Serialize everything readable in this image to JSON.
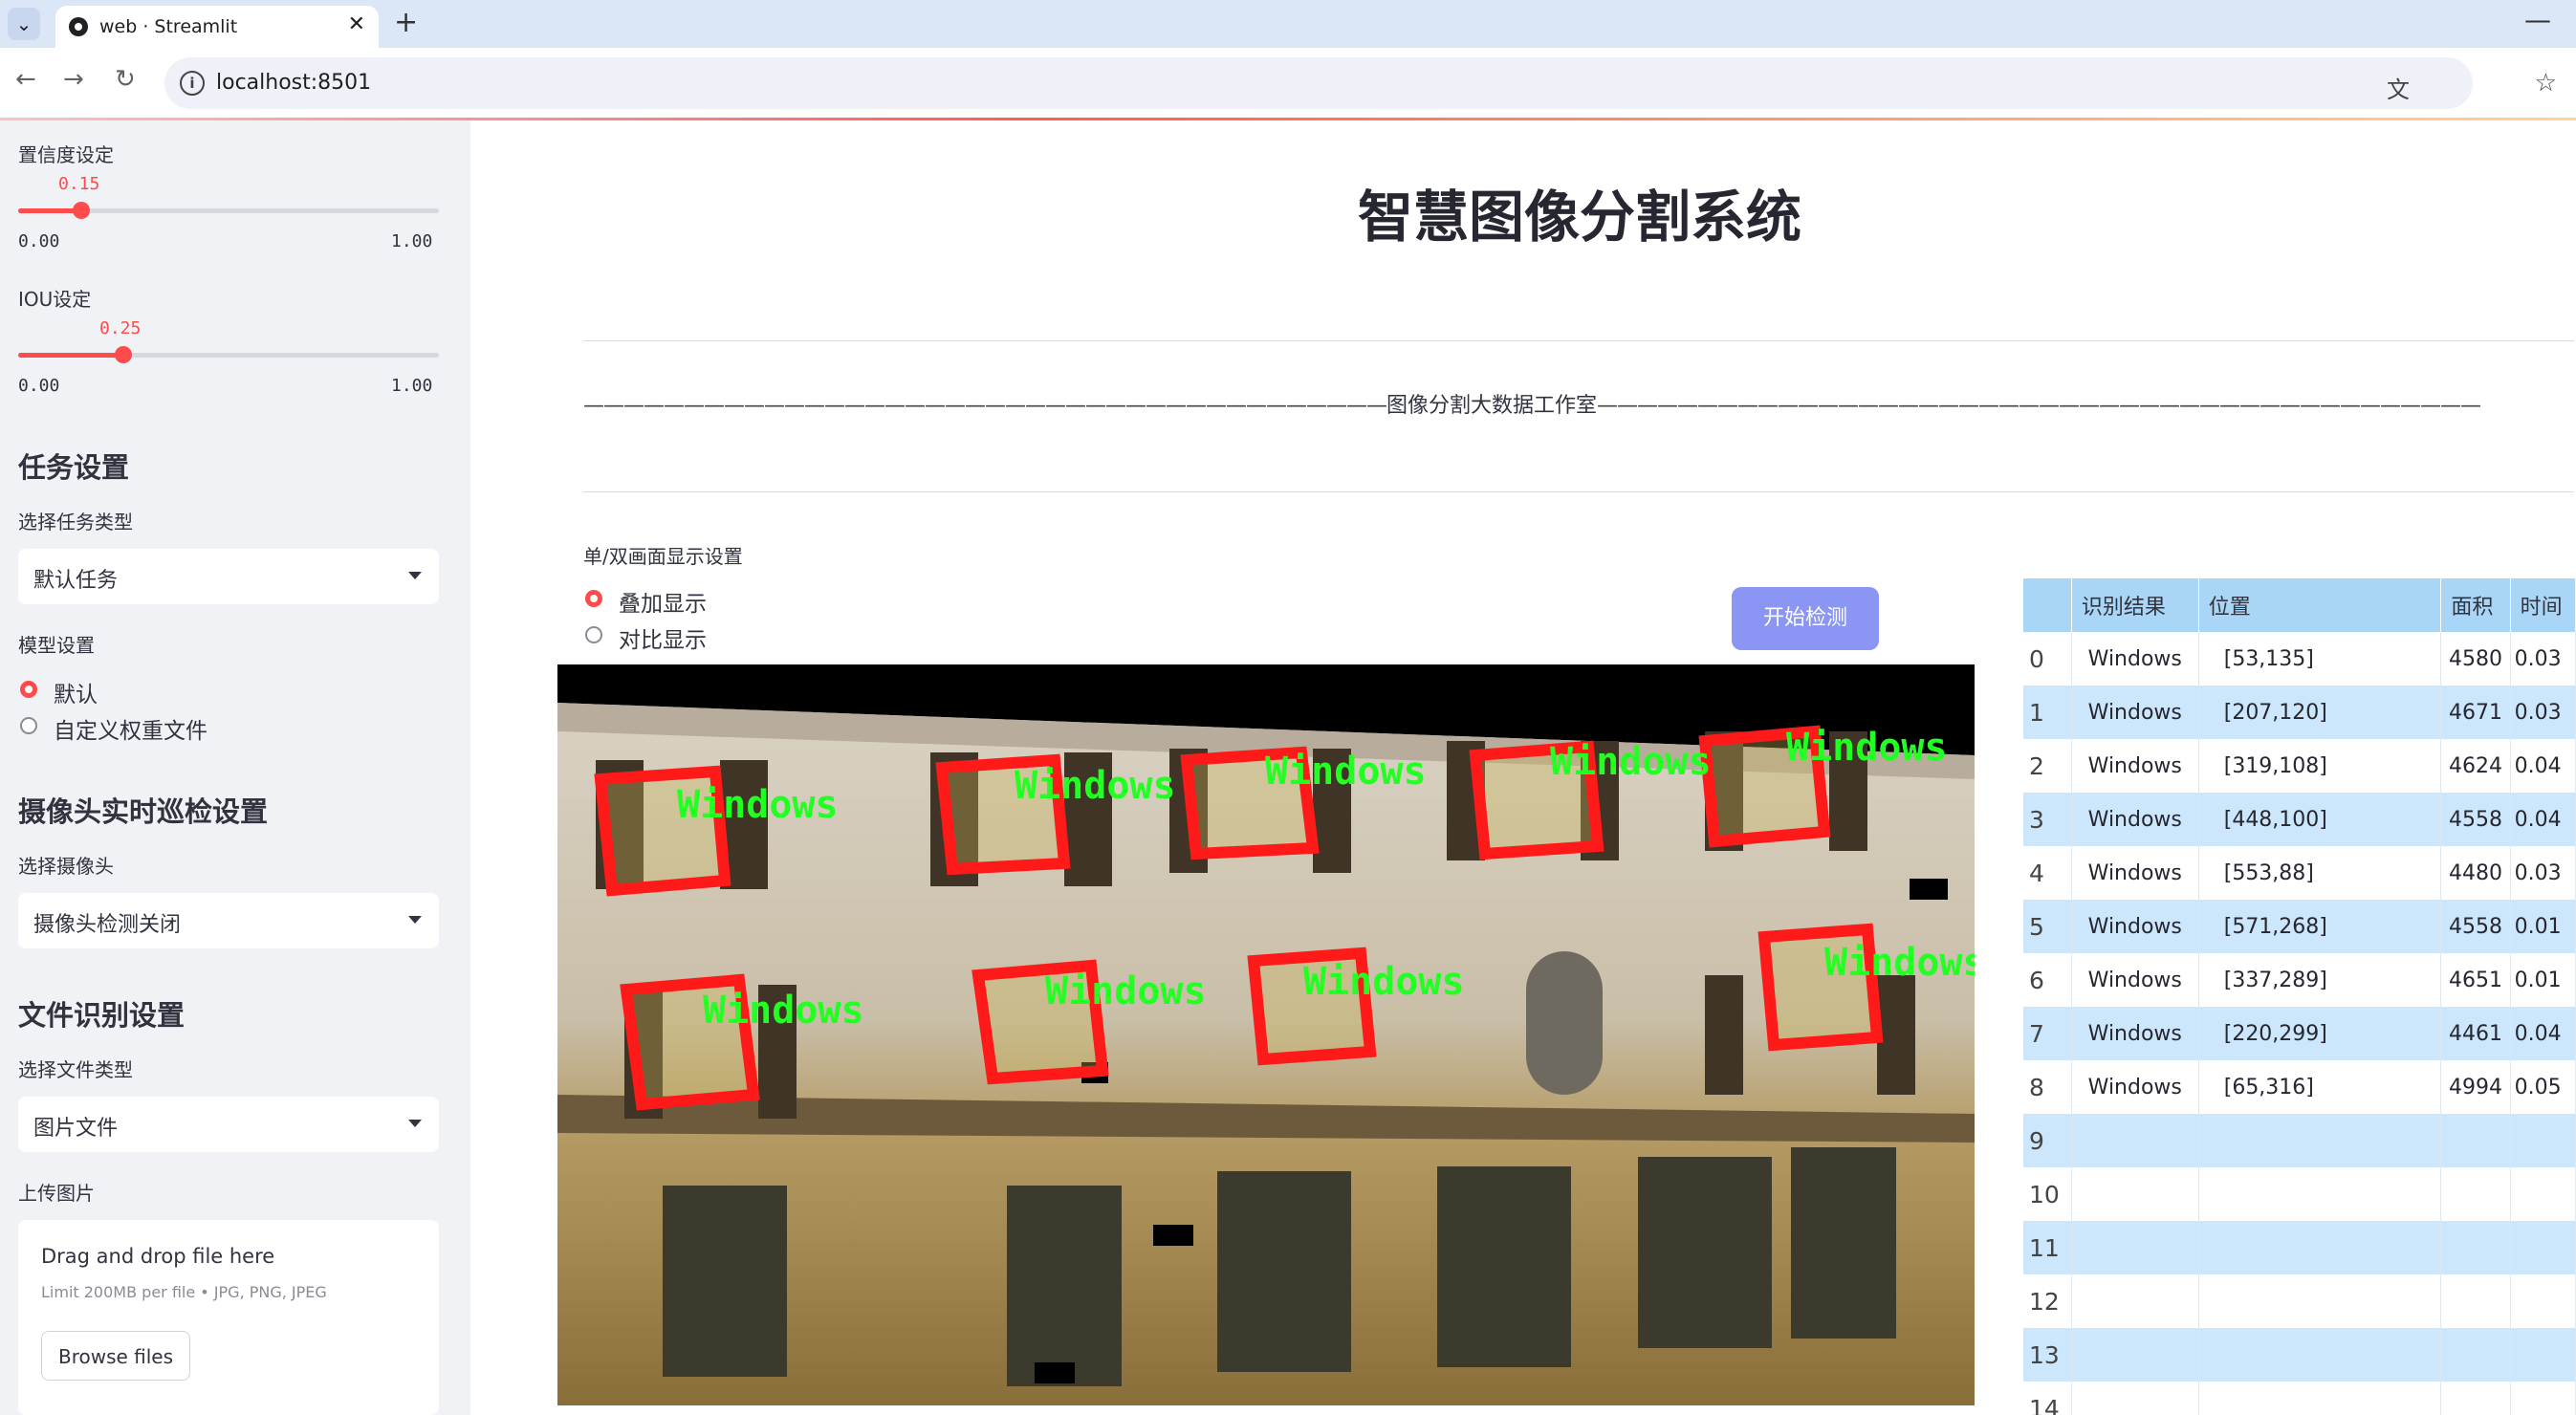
{
  "browser": {
    "tab_title": "web · Streamlit",
    "tab_close": "✕",
    "new_tab": "+",
    "dropdown_glyph": "⌄",
    "minimize_glyph": "—",
    "back_glyph": "←",
    "forward_glyph": "→",
    "reload_glyph": "↻",
    "info_glyph": "i",
    "translate_glyph": "⽂",
    "star_glyph": "☆",
    "url": "localhost:8501"
  },
  "sidebar": {
    "confidence": {
      "label": "置信度设定",
      "value": "0.15",
      "fraction": 0.15,
      "min": "0.00",
      "max": "1.00"
    },
    "iou": {
      "label": "IOU设定",
      "value": "0.25",
      "fraction": 0.25,
      "min": "0.00",
      "max": "1.00"
    },
    "task_header": "任务设置",
    "task_type_label": "选择任务类型",
    "task_type_value": "默认任务",
    "model_label": "模型设置",
    "model_options": [
      "默认",
      "自定义权重文件"
    ],
    "model_selected": 0,
    "camera_header": "摄像头实时巡检设置",
    "camera_label": "选择摄像头",
    "camera_value": "摄像头检测关闭",
    "file_header": "文件识别设置",
    "file_type_label": "选择文件类型",
    "file_type_value": "图片文件",
    "upload_label": "上传图片",
    "dropzone_title": "Drag and drop file here",
    "dropzone_limit": "Limit 200MB per file • JPG, PNG, JPEG",
    "browse_label": "Browse files"
  },
  "main": {
    "title": "智慧图像分割系统",
    "studio_dashes_left": "————————————————————————————————————————",
    "studio_text": "图像分割大数据工作室",
    "studio_dashes_right": "————————————————————————————————————————————",
    "display_label": "单/双画面显示设置",
    "display_options": [
      "叠加显示",
      "对比显示"
    ],
    "display_selected": 0,
    "detect_button": "开始检测",
    "detection_label": "Windows"
  },
  "table": {
    "columns": [
      "",
      "识别结果",
      "位置",
      "面积",
      "时间"
    ],
    "rows": [
      [
        "0",
        "Windows",
        "[53,135]",
        "4580",
        "0.03"
      ],
      [
        "1",
        "Windows",
        "[207,120]",
        "4671",
        "0.03"
      ],
      [
        "2",
        "Windows",
        "[319,108]",
        "4624",
        "0.04"
      ],
      [
        "3",
        "Windows",
        "[448,100]",
        "4558",
        "0.04"
      ],
      [
        "4",
        "Windows",
        "[553,88]",
        "4480",
        "0.03"
      ],
      [
        "5",
        "Windows",
        "[571,268]",
        "4558",
        "0.01"
      ],
      [
        "6",
        "Windows",
        "[337,289]",
        "4651",
        "0.01"
      ],
      [
        "7",
        "Windows",
        "[220,299]",
        "4461",
        "0.04"
      ],
      [
        "8",
        "Windows",
        "[65,316]",
        "4994",
        "0.05"
      ],
      [
        "9",
        "",
        "",
        "",
        ""
      ],
      [
        "10",
        "",
        "",
        "",
        ""
      ],
      [
        "11",
        "",
        "",
        "",
        ""
      ],
      [
        "12",
        "",
        "",
        "",
        ""
      ],
      [
        "13",
        "",
        "",
        "",
        ""
      ],
      [
        "14",
        "",
        "",
        "",
        ""
      ]
    ]
  }
}
